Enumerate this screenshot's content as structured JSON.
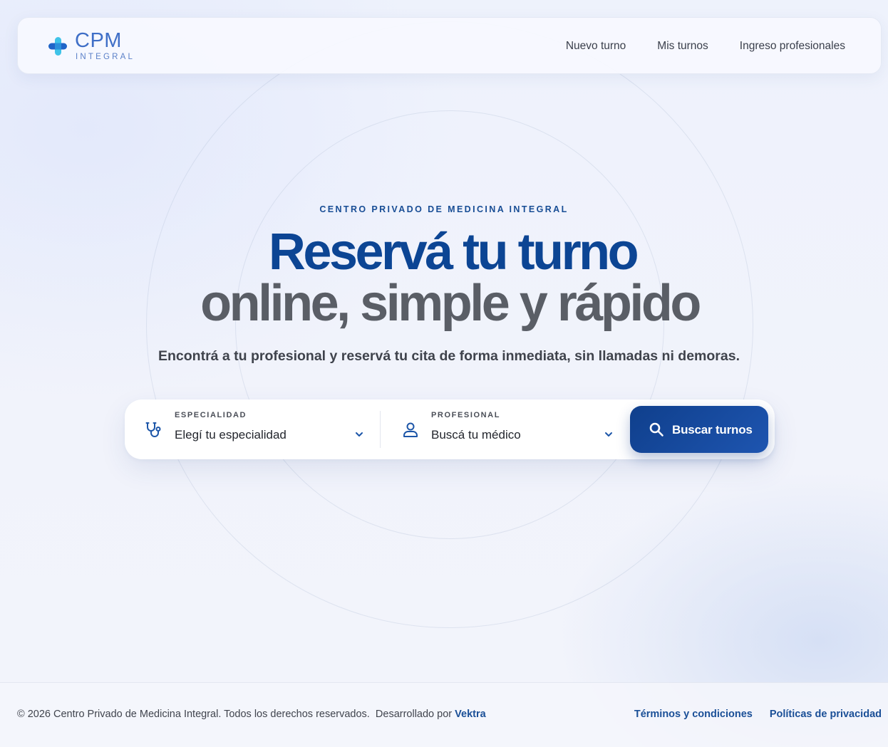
{
  "brand": {
    "title": "CPM",
    "subtitle": "INTEGRAL"
  },
  "nav": {
    "items": [
      {
        "label": "Nuevo turno"
      },
      {
        "label": "Mis turnos"
      },
      {
        "label": "Ingreso profesionales"
      }
    ]
  },
  "hero": {
    "eyebrow": "CENTRO PRIVADO DE MEDICINA INTEGRAL",
    "headline_line1": "Reservá tu turno",
    "headline_line2": "online, simple y rápido",
    "subtitle": "Encontrá a tu profesional y reservá tu cita de forma inmediata, sin llamadas ni demoras."
  },
  "search": {
    "specialty": {
      "label": "ESPECIALIDAD",
      "value": "Elegí tu especialidad",
      "icon": "stethoscope-icon"
    },
    "professional": {
      "label": "PROFESIONAL",
      "value": "Buscá tu médico",
      "icon": "user-icon"
    },
    "button_label": "Buscar turnos",
    "button_icon": "search-icon"
  },
  "footer": {
    "copyright": "© 2026 Centro Privado de Medicina Integral. Todos los derechos reservados.",
    "developed_by_label": "Desarrollado por",
    "developer": "Vektra",
    "links": [
      {
        "label": "Términos y condiciones"
      },
      {
        "label": "Políticas de privacidad"
      }
    ]
  },
  "colors": {
    "brand_primary": "#0c4594",
    "brand_light": "#3f6fc7",
    "logo_cross_dark": "#1f64c8",
    "logo_cross_light": "#3fc3e8",
    "headline_secondary": "#5a5e66"
  }
}
